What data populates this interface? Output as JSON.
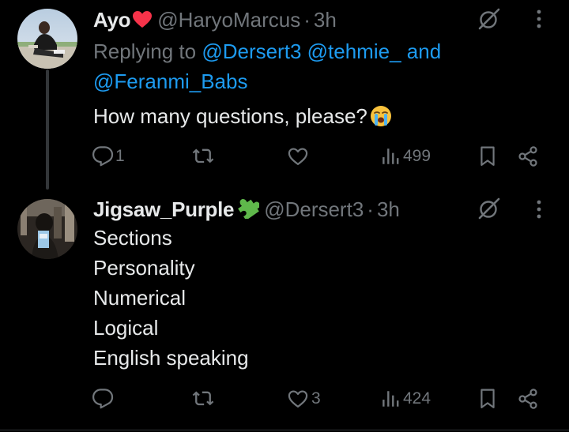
{
  "tweets": [
    {
      "display_name": "Ayo",
      "name_emoji": "red-heart",
      "handle": "@HaryoMarcus",
      "separator": "·",
      "time": "3h",
      "replying_label": "Replying to",
      "replying_mentions": [
        "@Dersert3",
        "@tehmie_",
        "and",
        "@Feranmi_Babs"
      ],
      "text_lines": [
        "How many questions, please?"
      ],
      "text_emoji": "loudly-crying-face",
      "actions": {
        "reply_count": "1",
        "retweet_count": "",
        "like_count": "",
        "views_count": "499"
      }
    },
    {
      "display_name": "Jigsaw_Purple",
      "name_emoji": "puzzle-piece",
      "handle": "@Dersert3",
      "separator": "·",
      "time": "3h",
      "text_lines": [
        "Sections",
        "Personality",
        "Numerical",
        "Logical",
        "English speaking"
      ],
      "actions": {
        "reply_count": "",
        "retweet_count": "",
        "like_count": "3",
        "views_count": "424"
      }
    }
  ],
  "colors": {
    "background": "#000000",
    "primary_text": "#e7e9ea",
    "secondary_text": "#71767b",
    "link": "#1d9bf0",
    "thread_line": "#333639",
    "divider": "#2f3336"
  },
  "icons": [
    "grok-icon",
    "more-icon",
    "reply-icon",
    "retweet-icon",
    "like-icon",
    "views-icon",
    "bookmark-icon",
    "share-icon"
  ]
}
